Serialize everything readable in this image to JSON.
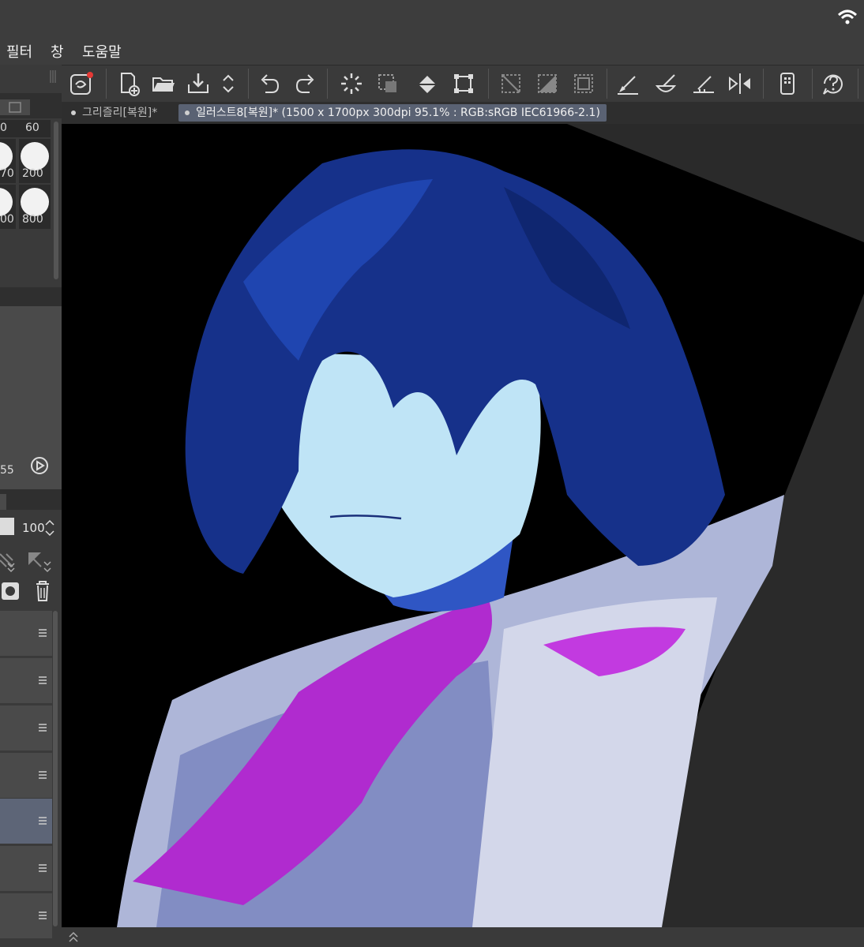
{
  "menu": {
    "items": [
      "필터",
      "창",
      "도움말"
    ]
  },
  "tabs": [
    {
      "label": "그리즐리[복원]*"
    },
    {
      "label": "일러스트8[복원]* (1500 x 1700px 300dpi 95.1% : RGB:sRGB IEC61966-2.1)"
    }
  ],
  "brush_sizes": {
    "top_left": "0",
    "top_right": "60",
    "row2_left": "70",
    "row2_right": "200",
    "row3_left": "00",
    "row3_right": "800"
  },
  "color": {
    "value_text": "55"
  },
  "layer": {
    "opacity": "100"
  },
  "icons": {
    "toolbar": [
      "clip-studio-icon",
      "new-document-icon",
      "open-folder-icon",
      "save-icon",
      "stepper-icon",
      "undo-icon",
      "redo-icon",
      "loading-spinner-icon",
      "select-invert-icon",
      "fill-icon",
      "transform-icon",
      "clear-selection-icon",
      "fill-layer-icon",
      "select-all-icon",
      "pen-line-icon",
      "brush-bowl-icon",
      "ruler-pen-icon",
      "flip-horizontal-icon",
      "device-icon",
      "help-icon"
    ]
  },
  "colors": {
    "accent_tab": "#5a6273",
    "selected_layer": "#5d6577",
    "hair": "#1a3a9a",
    "skin": "#bfe4f6",
    "scarf": "#b02bcf",
    "cloth": "#aeb6d8"
  }
}
